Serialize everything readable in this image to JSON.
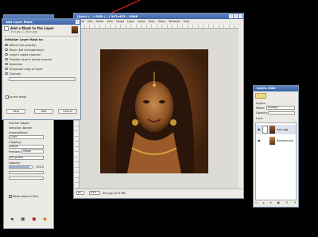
{
  "image_window": {
    "title": "[Asin] (...) RGB (...) 397x453 – GIMP",
    "menu": [
      "File",
      "Edit",
      "Select",
      "View",
      "Image",
      "Layer",
      "Colors",
      "Tools",
      "Filters",
      "Windows",
      "Help"
    ],
    "unit": "px",
    "zoom": "63%",
    "status": "Asin.jpg (42.9 MB)"
  },
  "dialog": {
    "title": "Add Layer Mask",
    "heading": "Add a Mask to the Layer",
    "subheading": "Asin.jpg-11 (Asin.jpg)",
    "section_label": "Initialize Layer Mask to:",
    "options": [
      "White (full opacity)",
      "Black (full transparency)",
      "Layer's alpha channel",
      "Transfer layer's alpha channel",
      "Selection",
      "Grayscale copy of layer",
      "Channel"
    ],
    "invert_label": "Invert mask",
    "help_label": "Help",
    "add_label": "Add",
    "cancel_label": "Cancel"
  },
  "toolbox": {
    "antialias_label": "Antialiasing",
    "feather_label": "Feather edges",
    "selection_label": "Selection Border",
    "interpolation_label": "Interpolation:",
    "interpolation_value": "Cubic",
    "clipping_label": "Clipping:",
    "clipping_value": "Adjust",
    "preview_label": "Preview:",
    "preview_value": "Image",
    "grid_label": "Guides:",
    "grid_value": "No guides",
    "opacity_label": "Opacity:",
    "opacity_value": "100.0",
    "keep_aspect_label": "Keep aspect (Ctrl)"
  },
  "layers_panel": {
    "title": "Layers, Undo",
    "tab_label": "Layers",
    "mode_label": "Mode:",
    "mode_value": "Multiply",
    "opacity_label": "Opacity:",
    "lock_label": "Lock:",
    "layers": [
      {
        "name": "Asin.jpg"
      },
      {
        "name": "Background"
      }
    ]
  },
  "colors": {
    "accent": "#3a64a8",
    "arrow": "#e02020"
  }
}
